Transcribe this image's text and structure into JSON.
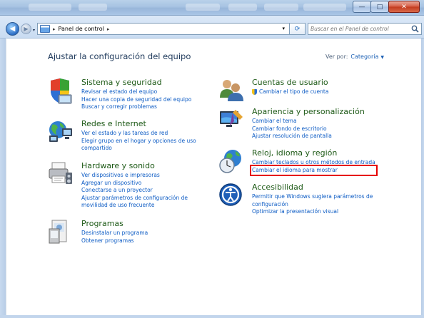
{
  "window": {
    "controls": {
      "minimize": "—",
      "maximize": "□",
      "close": "✕"
    }
  },
  "nav": {
    "back_icon": "back-arrow-icon",
    "forward_icon": "forward-arrow-icon",
    "history_dropdown": "▾",
    "breadcrumb": [
      "Panel de control"
    ],
    "address_dropdown": "▾",
    "refresh_symbol": "⟳",
    "search_placeholder": "Buscar en el Panel de control"
  },
  "header": {
    "title": "Ajustar la configuración del equipo",
    "view_by_label": "Ver por:",
    "view_by_value": "Categoría"
  },
  "categories": [
    {
      "id": "sistema",
      "icon": "shield-icon",
      "title": "Sistema y seguridad",
      "links": [
        "Revisar el estado del equipo",
        "Hacer una copia de seguridad del equipo",
        "Buscar y corregir problemas"
      ]
    },
    {
      "id": "redes",
      "icon": "globe-network-icon",
      "title": "Redes e Internet",
      "links": [
        "Ver el estado y las tareas de red",
        "Elegir grupo en el hogar y opciones de uso",
        "compartido"
      ]
    },
    {
      "id": "hardware",
      "icon": "printer-icon",
      "title": "Hardware y sonido",
      "links": [
        "Ver dispositivos e impresoras",
        "Agregar un dispositivo",
        "Conectarse a un proyector",
        "Ajustar parámetros de configuración de",
        "movilidad de uso frecuente"
      ]
    },
    {
      "id": "programas",
      "icon": "programs-icon",
      "title": "Programas",
      "links": [
        "Desinstalar un programa",
        "Obtener programas"
      ]
    },
    {
      "id": "cuentas",
      "icon": "users-icon",
      "title": "Cuentas de usuario",
      "links": [
        "Cambiar el tipo de cuenta"
      ]
    },
    {
      "id": "apariencia",
      "icon": "monitor-brush-icon",
      "title": "Apariencia y personalización",
      "links": [
        "Cambiar el tema",
        "Cambiar fondo de escritorio",
        "Ajustar resolución de pantalla"
      ]
    },
    {
      "id": "reloj",
      "icon": "clock-globe-icon",
      "title": "Reloj, idioma y región",
      "links": [
        "Cambiar teclados u otros métodos de entrada",
        "Cambiar el idioma para mostrar"
      ]
    },
    {
      "id": "accesibilidad",
      "icon": "accessibility-icon",
      "title": "Accesibilidad",
      "links": [
        "Permitir que Windows sugiera parámetros de",
        "configuración",
        "Optimizar la presentación visual"
      ]
    }
  ],
  "colors": {
    "category_title": "#1e5a17",
    "link": "#0c5bc4",
    "highlight": "#e60000"
  }
}
